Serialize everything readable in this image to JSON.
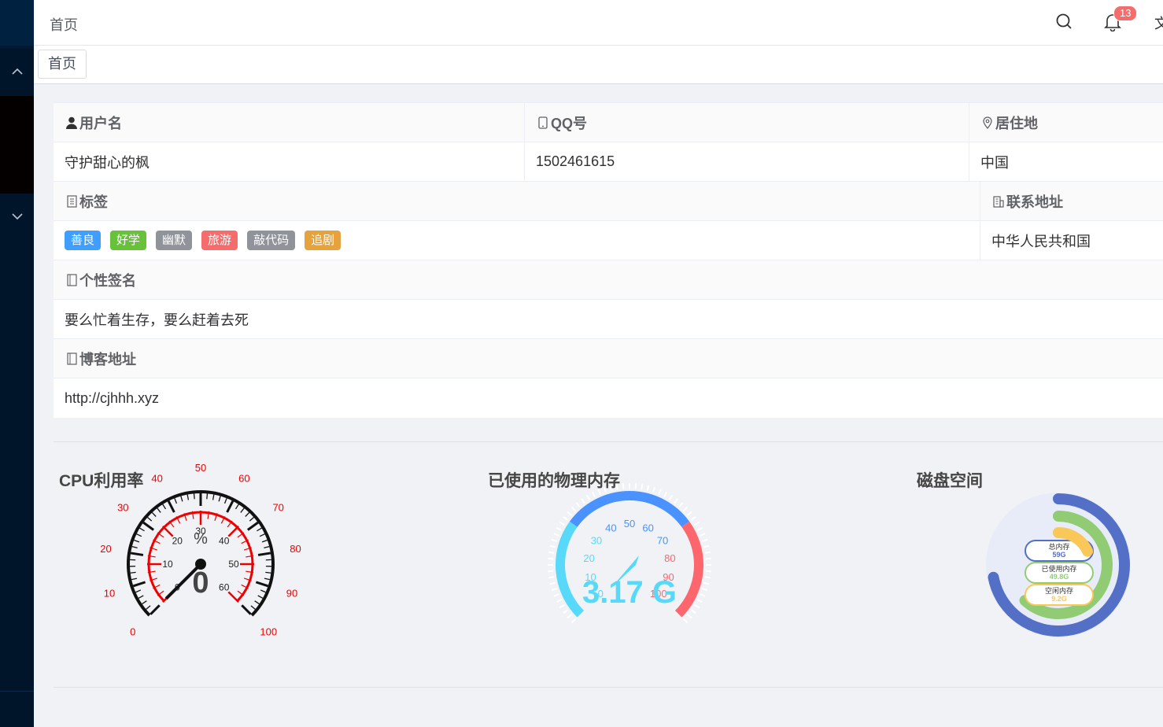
{
  "header": {
    "title": "首页",
    "notification_count": "13",
    "more_glyph": "文"
  },
  "tagsview": {
    "active_tag": "首页"
  },
  "profile": {
    "username_label": "用户名",
    "username": "守护甜心的枫",
    "qq_label": "QQ号",
    "qq": "1502461615",
    "residence_label": "居住地",
    "residence": "中国",
    "tags_label": "标签",
    "tags": [
      {
        "text": "善良",
        "color": "#409eff"
      },
      {
        "text": "好学",
        "color": "#67c23a"
      },
      {
        "text": "幽默",
        "color": "#909399"
      },
      {
        "text": "旅游",
        "color": "#f56c6c"
      },
      {
        "text": "敲代码",
        "color": "#909399"
      },
      {
        "text": "追剧",
        "color": "#e6a23c"
      }
    ],
    "address_label": "联系地址",
    "address": "中华人民共和国",
    "signature_label": "个性签名",
    "signature": "要么忙着生存，要么赶着去死",
    "blog_label": "博客地址",
    "blog": "http://cjhhh.xyz"
  },
  "cpu": {
    "title": "CPU利用率",
    "unit": "%",
    "value": "0",
    "outer_ticks": [
      "0",
      "10",
      "20",
      "30",
      "40",
      "50",
      "60",
      "70",
      "80",
      "90",
      "100"
    ],
    "inner_ticks": [
      "0",
      "10",
      "20",
      "30",
      "40",
      "50",
      "60"
    ]
  },
  "memory": {
    "title": "已使用的物理内存",
    "value": "3.17 G",
    "ticks": [
      "0",
      "10",
      "20",
      "30",
      "40",
      "50",
      "60",
      "70",
      "80",
      "90",
      "100"
    ],
    "colors": {
      "low": "#58d9f9",
      "mid": "#4992ff",
      "high": "#fd666d"
    }
  },
  "disk": {
    "title": "磁盘空间",
    "items": [
      {
        "name": "总内存",
        "value": "59G",
        "color": "#5470c6"
      },
      {
        "name": "已使用内存",
        "value": "49.8G",
        "color": "#91cc75"
      },
      {
        "name": "空闲内存",
        "value": "9.2G",
        "color": "#fac858"
      }
    ]
  }
}
